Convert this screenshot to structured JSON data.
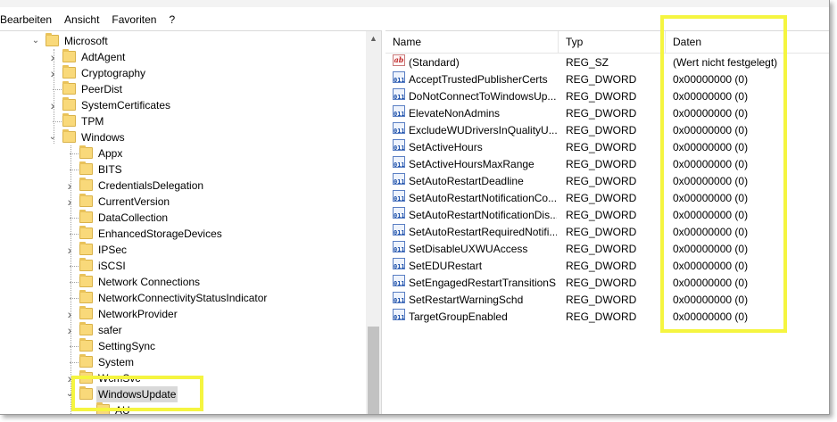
{
  "menubar": {
    "items": [
      "Bearbeiten",
      "Ansicht",
      "Favoriten",
      "?"
    ]
  },
  "tree": {
    "nodes": [
      {
        "label": "Microsoft",
        "expanded": true
      },
      {
        "label": "AdtAgent",
        "expandable": true
      },
      {
        "label": "Cryptography",
        "expandable": true
      },
      {
        "label": "PeerDist"
      },
      {
        "label": "SystemCertificates",
        "expandable": true
      },
      {
        "label": "TPM"
      },
      {
        "label": "Windows",
        "expanded": true
      },
      {
        "label": "Appx"
      },
      {
        "label": "BITS"
      },
      {
        "label": "CredentialsDelegation",
        "expandable": true
      },
      {
        "label": "CurrentVersion",
        "expandable": true
      },
      {
        "label": "DataCollection"
      },
      {
        "label": "EnhancedStorageDevices"
      },
      {
        "label": "IPSec",
        "expandable": true
      },
      {
        "label": "iSCSI"
      },
      {
        "label": "Network Connections"
      },
      {
        "label": "NetworkConnectivityStatusIndicator"
      },
      {
        "label": "NetworkProvider",
        "expandable": true
      },
      {
        "label": "safer",
        "expandable": true
      },
      {
        "label": "SettingSync"
      },
      {
        "label": "System"
      },
      {
        "label": "WcmSvc",
        "expandable": true
      },
      {
        "label": "WindowsUpdate",
        "expanded": true,
        "selected": true
      },
      {
        "label": "AU"
      }
    ]
  },
  "list": {
    "columns": {
      "name": "Name",
      "type": "Typ",
      "data": "Daten"
    },
    "rows": [
      {
        "name": "(Standard)",
        "type": "REG_SZ",
        "data": "(Wert nicht festgelegt)",
        "icon": "string-value-icon"
      },
      {
        "name": "AcceptTrustedPublisherCerts",
        "type": "REG_DWORD",
        "data": "0x00000000 (0)",
        "icon": "dword-value-icon"
      },
      {
        "name": "DoNotConnectToWindowsUp...",
        "type": "REG_DWORD",
        "data": "0x00000000 (0)",
        "icon": "dword-value-icon"
      },
      {
        "name": "ElevateNonAdmins",
        "type": "REG_DWORD",
        "data": "0x00000000 (0)",
        "icon": "dword-value-icon"
      },
      {
        "name": "ExcludeWUDriversInQualityU...",
        "type": "REG_DWORD",
        "data": "0x00000000 (0)",
        "icon": "dword-value-icon"
      },
      {
        "name": "SetActiveHours",
        "type": "REG_DWORD",
        "data": "0x00000000 (0)",
        "icon": "dword-value-icon"
      },
      {
        "name": "SetActiveHoursMaxRange",
        "type": "REG_DWORD",
        "data": "0x00000000 (0)",
        "icon": "dword-value-icon"
      },
      {
        "name": "SetAutoRestartDeadline",
        "type": "REG_DWORD",
        "data": "0x00000000 (0)",
        "icon": "dword-value-icon"
      },
      {
        "name": "SetAutoRestartNotificationCo...",
        "type": "REG_DWORD",
        "data": "0x00000000 (0)",
        "icon": "dword-value-icon"
      },
      {
        "name": "SetAutoRestartNotificationDis...",
        "type": "REG_DWORD",
        "data": "0x00000000 (0)",
        "icon": "dword-value-icon"
      },
      {
        "name": "SetAutoRestartRequiredNotifi...",
        "type": "REG_DWORD",
        "data": "0x00000000 (0)",
        "icon": "dword-value-icon"
      },
      {
        "name": "SetDisableUXWUAccess",
        "type": "REG_DWORD",
        "data": "0x00000000 (0)",
        "icon": "dword-value-icon"
      },
      {
        "name": "SetEDURestart",
        "type": "REG_DWORD",
        "data": "0x00000000 (0)",
        "icon": "dword-value-icon"
      },
      {
        "name": "SetEngagedRestartTransitionS...",
        "type": "REG_DWORD",
        "data": "0x00000000 (0)",
        "icon": "dword-value-icon"
      },
      {
        "name": "SetRestartWarningSchd",
        "type": "REG_DWORD",
        "data": "0x00000000 (0)",
        "icon": "dword-value-icon"
      },
      {
        "name": "TargetGroupEnabled",
        "type": "REG_DWORD",
        "data": "0x00000000 (0)",
        "icon": "dword-value-icon"
      }
    ]
  },
  "colors": {
    "highlight": "#f5f540",
    "folder": "#f9d97a",
    "selection": "#d9d9d9"
  }
}
